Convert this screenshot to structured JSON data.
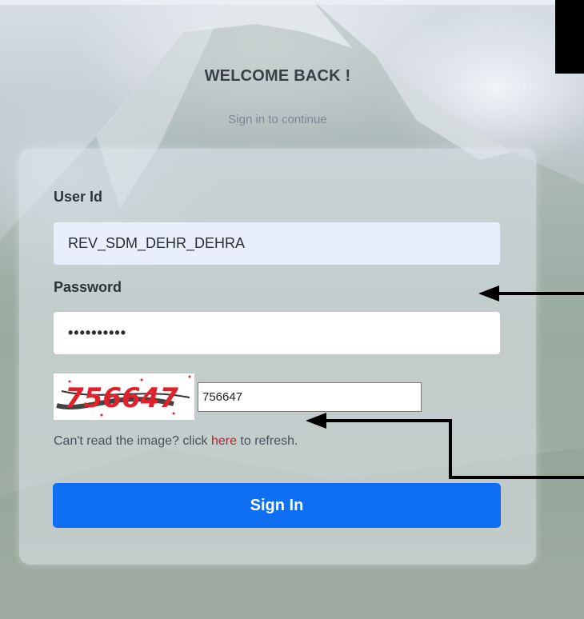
{
  "header": {
    "title": "WELCOME BACK !",
    "subtitle": "Sign in to continue"
  },
  "form": {
    "user_id_label": "User Id",
    "user_id_value": "REV_SDM_DEHR_DEHRA",
    "password_label": "Password",
    "password_value": "••••••••••",
    "captcha_image_text": "756647",
    "captcha_value": "756647",
    "help_prefix": "Can't read the image? click ",
    "help_link": "here",
    "help_suffix": " to refresh.",
    "submit_label": "Sign In"
  },
  "colors": {
    "button": "#0f6ff3",
    "link": "#b4232a",
    "captcha_text": "#e0202a"
  }
}
